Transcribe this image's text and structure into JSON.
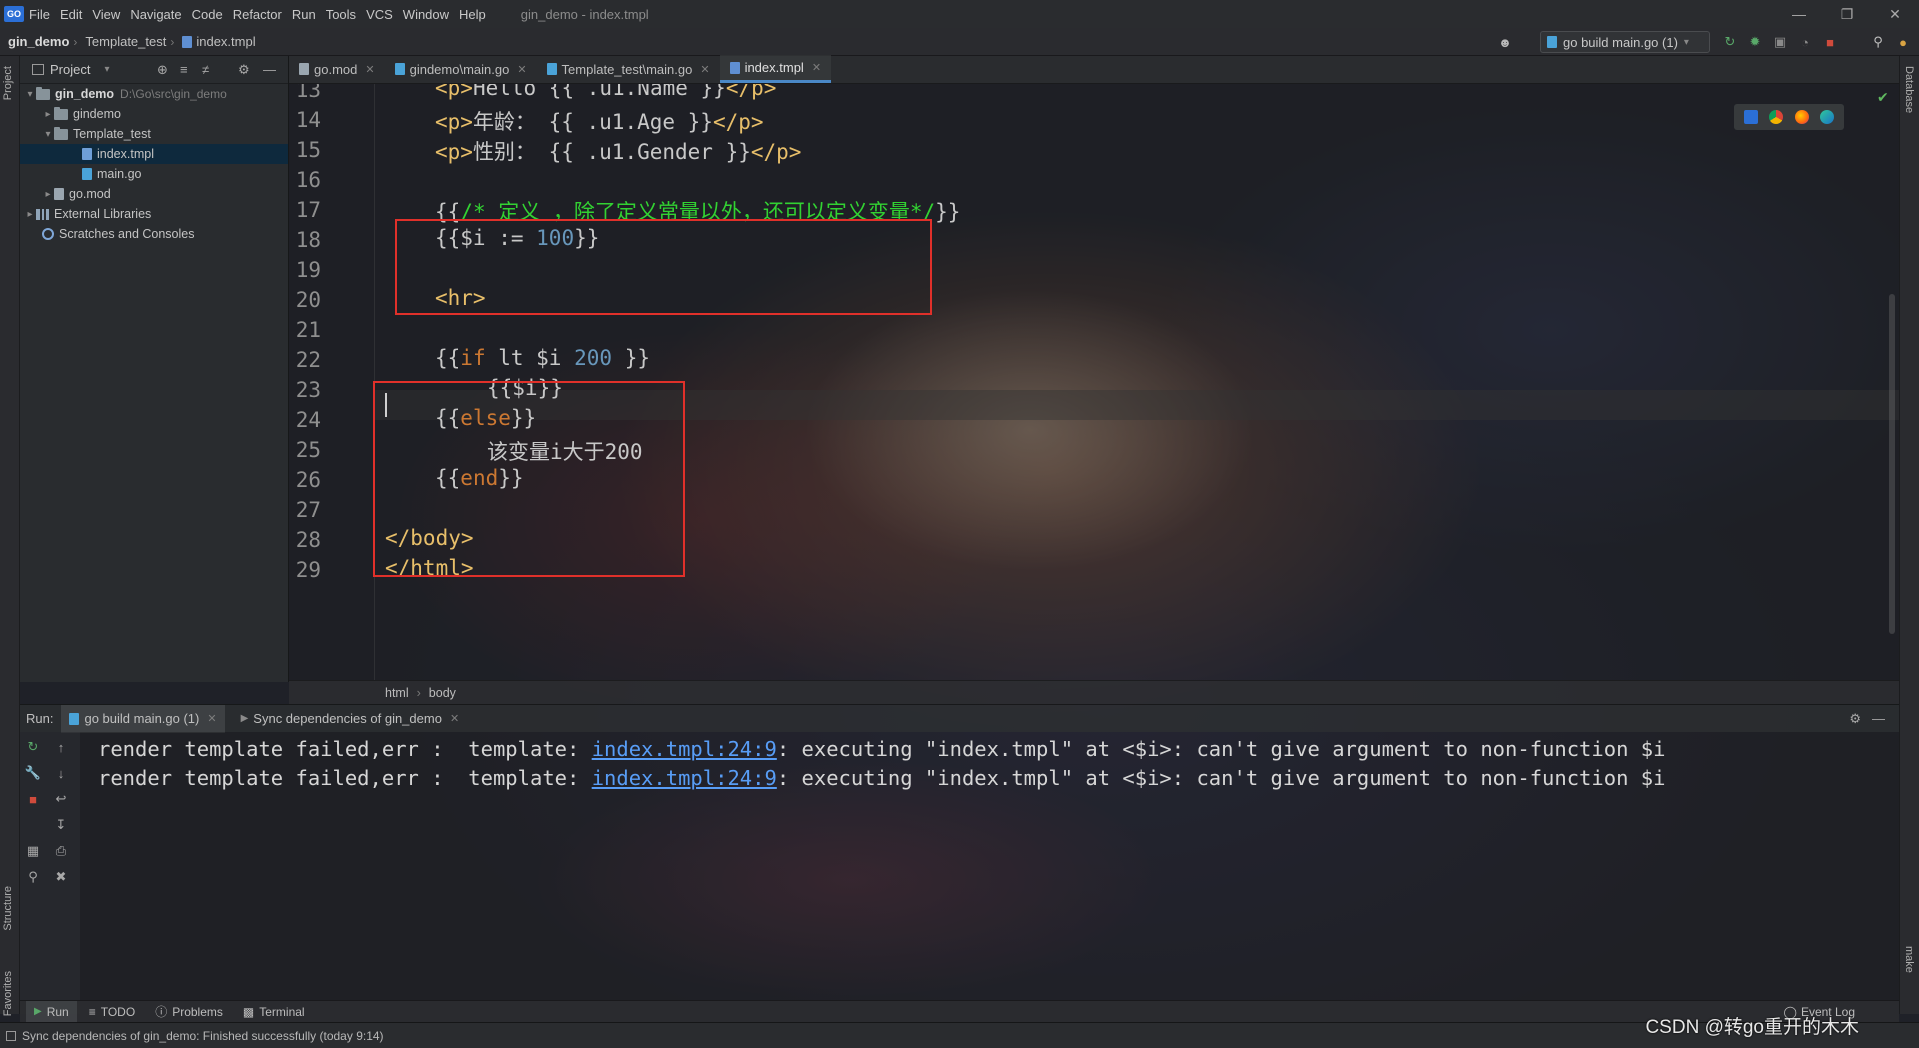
{
  "app": {
    "logo": "GO",
    "window_title": "gin_demo - index.tmpl",
    "menu": [
      "File",
      "Edit",
      "View",
      "Navigate",
      "Code",
      "Refactor",
      "Run",
      "Tools",
      "VCS",
      "Window",
      "Help"
    ]
  },
  "navbar": {
    "crumbs": [
      "gin_demo",
      "Template_test",
      "index.tmpl"
    ],
    "run_config": "go build main.go (1)"
  },
  "project": {
    "header": "Project",
    "tree": [
      {
        "label": "gin_demo",
        "dim": "D:\\Go\\src\\gin_demo",
        "arrow": "▾",
        "icon": "folder"
      },
      {
        "label": "gindemo",
        "arrow": "▸",
        "icon": "folder"
      },
      {
        "label": "Template_test",
        "arrow": "▾",
        "icon": "folder"
      },
      {
        "label": "index.tmpl",
        "arrow": "",
        "icon": "file",
        "selected": true
      },
      {
        "label": "main.go",
        "arrow": "",
        "icon": "file"
      },
      {
        "label": "go.mod",
        "arrow": "▸",
        "icon": "folder"
      },
      {
        "label": "External Libraries",
        "arrow": "▸",
        "icon": "lib"
      },
      {
        "label": "Scratches and Consoles",
        "arrow": "",
        "icon": "scratch"
      }
    ]
  },
  "left_stripe": {
    "project": "Project",
    "structure": "Structure",
    "favorites": "Favorites"
  },
  "right_stripe": {
    "database": "Database",
    "make": "make"
  },
  "tabs": [
    {
      "label": "go.mod",
      "active": false
    },
    {
      "label": "gindemo\\main.go",
      "active": false
    },
    {
      "label": "Template_test\\main.go",
      "active": false
    },
    {
      "label": "index.tmpl",
      "active": true
    }
  ],
  "editor": {
    "line_numbers": [
      "13",
      "14",
      "15",
      "16",
      "17",
      "18",
      "19",
      "20",
      "21",
      "22",
      "23",
      "24",
      "25",
      "26",
      "27",
      "28",
      "29"
    ],
    "lines": {
      "l13": {
        "open": "<p>",
        "text": "Hello {{ .u1.Name }}",
        "close": "</p>"
      },
      "l14": {
        "open": "<p>",
        "text": "年龄： {{ .u1.Age }}",
        "close": "</p>"
      },
      "l15": {
        "open": "<p>",
        "text": "性别： {{ .u1.Gender }}",
        "close": "</p>"
      },
      "l17": {
        "a": "{{",
        "comment": "/* 定义 ，除了定义常量以外，还可以定义变量*/",
        "b": "}}"
      },
      "l18": {
        "a": "{{$i := ",
        "num": "100",
        "b": "}}"
      },
      "l20": {
        "tag": "<hr>"
      },
      "l22": {
        "a": "{{",
        "kw": "if",
        "b": " lt $i ",
        "num": "200",
        "c": " }}"
      },
      "l23": {
        "text": "{{$i}}"
      },
      "l24": {
        "a": "{{",
        "kw": "else",
        "b": "}}"
      },
      "l25": {
        "text": "该变量i大于200"
      },
      "l26": {
        "a": "{{",
        "kw": "end",
        "b": "}}"
      },
      "l28": {
        "tag": "</body>"
      },
      "l29": {
        "tag": "</html>"
      }
    },
    "breadcrumbs": [
      "html",
      "body"
    ]
  },
  "run": {
    "label": "Run:",
    "tabs": [
      "go build main.go (1)",
      "Sync dependencies of gin_demo"
    ],
    "console": [
      {
        "pre": "render template failed,err :  template: ",
        "link": "index.tmpl:24:9",
        "post": ": executing \"index.tmpl\" at <$i>: can't give argument to non-function $i"
      },
      {
        "pre": "render template failed,err :  template: ",
        "link": "index.tmpl:24:9",
        "post": ": executing \"index.tmpl\" at <$i>: can't give argument to non-function $i"
      }
    ]
  },
  "bottom_tabs": [
    "Run",
    "TODO",
    "Problems",
    "Terminal"
  ],
  "event_log": "Event Log",
  "status": "Sync dependencies of gin_demo: Finished successfully (today 9:14)",
  "watermark": "CSDN @转go重开的木木",
  "colors": {
    "highlight_box": "#e0302a",
    "tag": "#e8bf6a",
    "keyword": "#cc7832",
    "number": "#6897bb",
    "comment": "#32d232",
    "link": "#589df6"
  }
}
